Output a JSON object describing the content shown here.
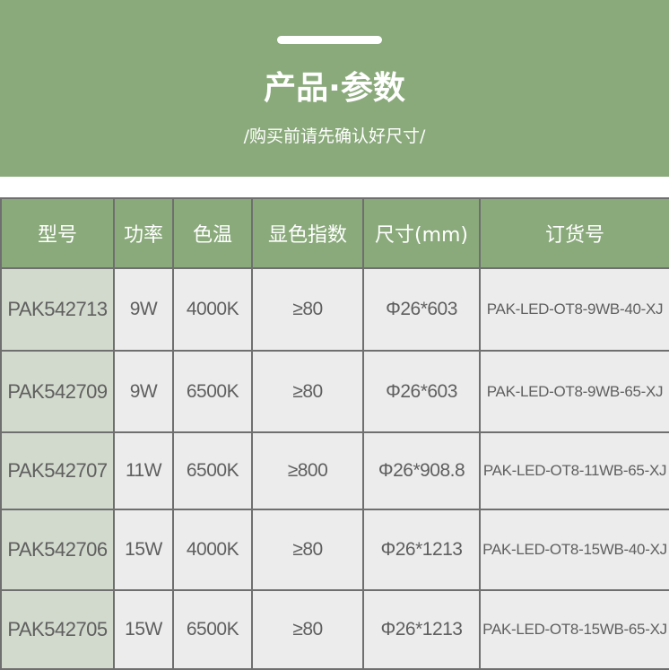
{
  "header": {
    "title": "产品·参数",
    "subtitle": "/购买前请先确认好尺寸/",
    "background_color": "#8aaa7b"
  },
  "table": {
    "columns": [
      "型号",
      "功率",
      "色温",
      "显色指数",
      "尺寸(mm)",
      "订货号"
    ],
    "rows": [
      {
        "model": "PAK542713",
        "power": "9W",
        "cct": "4000K",
        "cri": "≥80",
        "size": "Φ26*603",
        "order": "PAK-LED-OT8-9WB-40-XJ"
      },
      {
        "model": "PAK542709",
        "power": "9W",
        "cct": "6500K",
        "cri": "≥80",
        "size": "Φ26*603",
        "order": "PAK-LED-OT8-9WB-65-XJ"
      },
      {
        "model": "PAK542707",
        "power": "11W",
        "cct": "6500K",
        "cri": "≥800",
        "size": "Φ26*908.8",
        "order": "PAK-LED-OT8-11WB-65-XJ"
      },
      {
        "model": "PAK542706",
        "power": "15W",
        "cct": "4000K",
        "cri": "≥80",
        "size": "Φ26*1213",
        "order": "PAK-LED-OT8-15WB-40-XJ"
      },
      {
        "model": "PAK542705",
        "power": "15W",
        "cct": "6500K",
        "cri": "≥80",
        "size": "Φ26*1213",
        "order": "PAK-LED-OT8-15WB-65-XJ"
      }
    ]
  }
}
